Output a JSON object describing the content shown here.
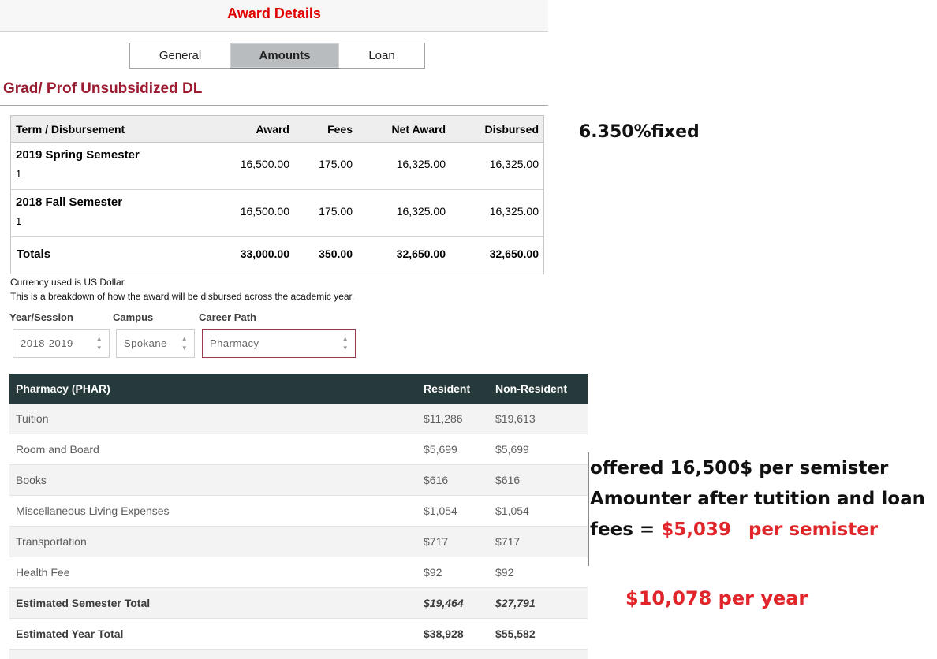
{
  "header": {
    "title": "Award Details"
  },
  "tabs": [
    {
      "label": "General",
      "active": false
    },
    {
      "label": "Amounts",
      "active": true
    },
    {
      "label": "Loan",
      "active": false
    }
  ],
  "loan": {
    "title": "Grad/ Prof Unsubsidized DL",
    "columns": [
      "Term / Disbursement",
      "Award",
      "Fees",
      "Net Award",
      "Disbursed"
    ],
    "rows": [
      {
        "term": "2019 Spring Semester",
        "disbursement": "1",
        "award": "16,500.00",
        "fees": "175.00",
        "net": "16,325.00",
        "disbursed": "16,325.00"
      },
      {
        "term": "2018 Fall Semester",
        "disbursement": "1",
        "award": "16,500.00",
        "fees": "175.00",
        "net": "16,325.00",
        "disbursed": "16,325.00"
      }
    ],
    "totals": {
      "label": "Totals",
      "award": "33,000.00",
      "fees": "350.00",
      "net": "32,650.00",
      "disbursed": "32,650.00"
    },
    "currency_note": "Currency used is US Dollar",
    "breakdown_note": "This is a breakdown of how the award will be disbursed across the academic year."
  },
  "selectors": {
    "year": {
      "label": "Year/Session",
      "value": "2018-2019"
    },
    "campus": {
      "label": "Campus",
      "value": "Spokane"
    },
    "career": {
      "label": "Career Path",
      "value": "Pharmacy"
    }
  },
  "cost_table": {
    "header": {
      "program": "Pharmacy (PHAR)",
      "resident": "Resident",
      "nonresident": "Non-Resident"
    },
    "rows": [
      {
        "item": "Tuition",
        "resident": "$11,286",
        "nonresident": "$19,613"
      },
      {
        "item": "Room and Board",
        "resident": "$5,699",
        "nonresident": "$5,699"
      },
      {
        "item": "Books",
        "resident": "$616",
        "nonresident": "$616"
      },
      {
        "item": "Miscellaneous Living Expenses",
        "resident": "$1,054",
        "nonresident": "$1,054"
      },
      {
        "item": "Transportation",
        "resident": "$717",
        "nonresident": "$717"
      },
      {
        "item": "Health Fee",
        "resident": "$92",
        "nonresident": "$92"
      },
      {
        "item": "Estimated Semester Total",
        "resident": "$19,464",
        "nonresident": "$27,791"
      },
      {
        "item": "Estimated Year Total",
        "resident": "$38,928",
        "nonresident": "$55,582"
      }
    ]
  },
  "annotations": {
    "rate": "6.350%fixed",
    "line1": "offered 16,500$ per semister",
    "line2": "Amounter after tutition and loan",
    "line3_prefix": "fees = ",
    "line3_amount": "$5,039",
    "line3_suffix": "per semister",
    "year_total": "$10,078 per year"
  },
  "colors": {
    "title_red": "#e00000",
    "loan_title": "#9b1c31",
    "header_dark": "#263a3b",
    "annotation_red": "#e0262a"
  }
}
